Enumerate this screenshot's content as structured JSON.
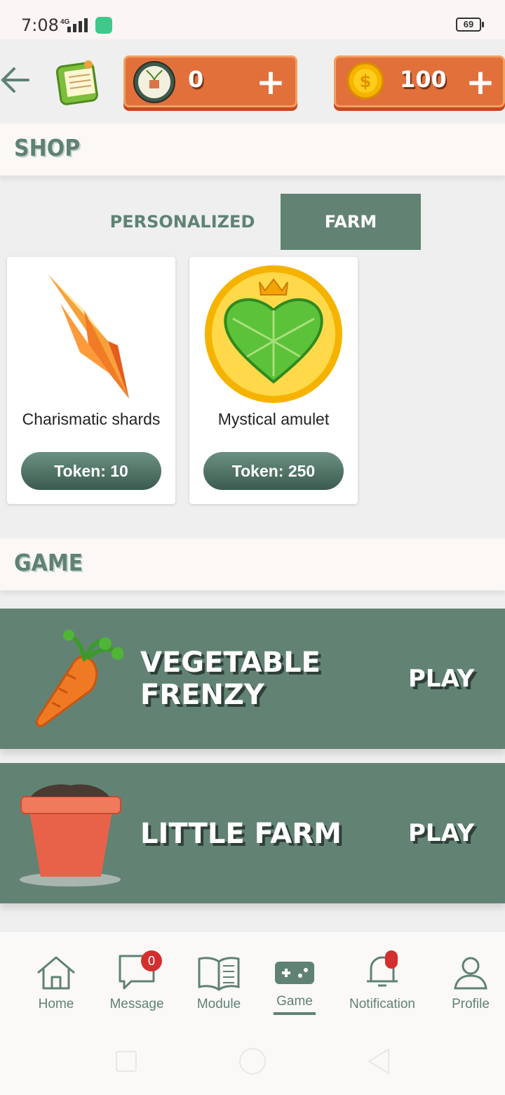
{
  "status_bar": {
    "time": "7:08",
    "network": "4G",
    "battery": "69"
  },
  "header": {
    "token_count": "0",
    "coin_count": "100",
    "plus_symbol": "+"
  },
  "shop": {
    "title": "SHOP",
    "tabs": [
      {
        "label": "PERSONALIZED",
        "active": false
      },
      {
        "label": "FARM",
        "active": true
      }
    ],
    "items": [
      {
        "name": "Charismatic shards",
        "price_label": "Token: 10"
      },
      {
        "name": "Mystical amulet",
        "price_label": "Token: 250"
      }
    ]
  },
  "game": {
    "title": "GAME",
    "games": [
      {
        "title_line1": "VEGETABLE",
        "title_line2": "FRENZY",
        "play_label": "PLAY"
      },
      {
        "title_line1": "LITTLE FARM",
        "title_line2": "",
        "play_label": "PLAY"
      }
    ]
  },
  "nav": {
    "items": [
      {
        "label": "Home",
        "icon": "home-icon"
      },
      {
        "label": "Message",
        "icon": "message-icon",
        "badge": "0"
      },
      {
        "label": "Module",
        "icon": "book-icon"
      },
      {
        "label": "Game",
        "icon": "gamepad-icon",
        "active": true
      },
      {
        "label": "Notification",
        "icon": "bell-icon"
      },
      {
        "label": "Profile",
        "icon": "person-icon"
      }
    ]
  },
  "colors": {
    "accent": "#628374",
    "orange": "#e2703a",
    "badge": "#d32f2f"
  }
}
